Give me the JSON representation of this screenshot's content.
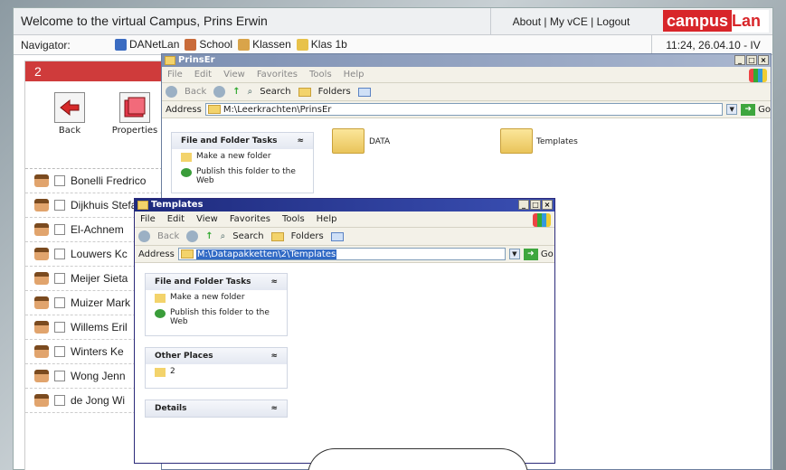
{
  "portal": {
    "welcome": "Welcome to the virtual Campus, Prins Erwin",
    "links": "About | My vCE | Logout",
    "logo_campus": "campus",
    "logo_lan": "Lan",
    "navigator_label": "Navigator:",
    "crumbs": [
      "DANetLan",
      "School",
      "Klassen",
      "Klas 1b"
    ],
    "clock": "11:24, 26.04.10 - IV"
  },
  "left": {
    "tab": "2",
    "back": "Back",
    "properties": "Properties",
    "students": [
      "Bonelli Fredrico",
      "Dijkhuis Stefan",
      "El-Achnem",
      "Louwers Kc",
      "Meijer Sieta",
      "Muizer Mark",
      "Willems Eril",
      "Winters Ke",
      "Wong Jenn",
      "de Jong Wi"
    ]
  },
  "win1": {
    "title": "PrinsEr",
    "menu": [
      "File",
      "Edit",
      "View",
      "Favorites",
      "Tools",
      "Help"
    ],
    "back": "Back",
    "search": "Search",
    "folders": "Folders",
    "address_label": "Address",
    "address": "M:\\Leerkrachten\\PrinsEr",
    "go": "Go",
    "task_header": "File and Folder Tasks",
    "task1": "Make a new folder",
    "task2": "Publish this folder to the Web",
    "folder1": "DATA",
    "folder2": "Templates"
  },
  "win2": {
    "title": "Templates",
    "menu": [
      "File",
      "Edit",
      "View",
      "Favorites",
      "Tools",
      "Help"
    ],
    "back": "Back",
    "search": "Search",
    "folders": "Folders",
    "address_label": "Address",
    "address": "M:\\Datapakketten\\2\\Templates",
    "go": "Go",
    "task_header": "File and Folder Tasks",
    "task1": "Make a new folder",
    "task2": "Publish this folder to the Web",
    "other_header": "Other Places",
    "other1": "2",
    "details_header": "Details"
  },
  "colors": {
    "accent": "#d8262a",
    "xp_blue": "#2a55b0",
    "xp_title_active": "#2b2a7a"
  }
}
